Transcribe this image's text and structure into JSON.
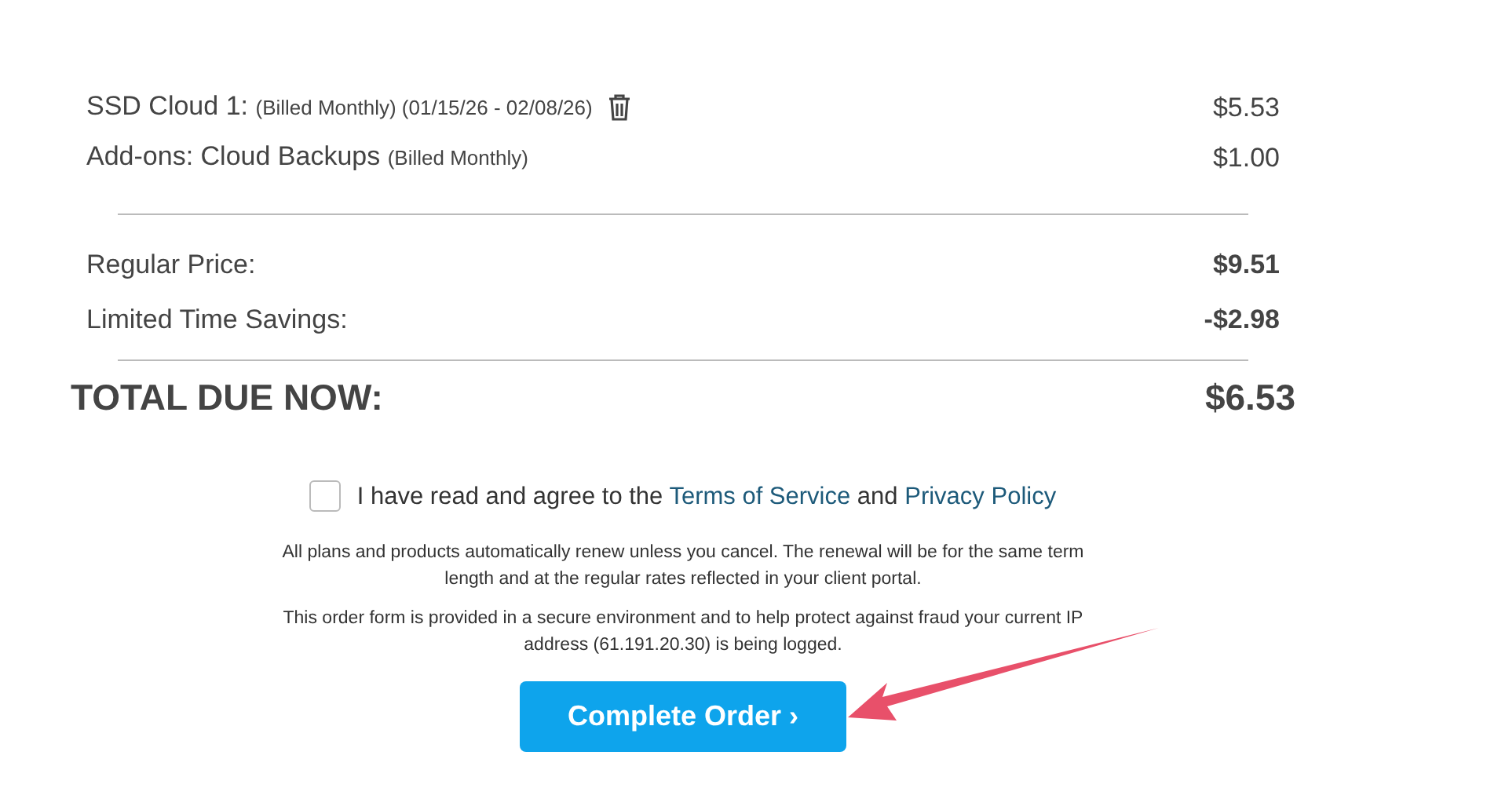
{
  "line_items": [
    {
      "name": "SSD Cloud 1:",
      "detail": "(Billed Monthly) (01/15/26 - 02/08/26)",
      "removable": true,
      "price": "$5.53"
    },
    {
      "name": "Add-ons: Cloud Backups",
      "detail": "(Billed Monthly)",
      "removable": false,
      "price": "$1.00"
    }
  ],
  "summary": [
    {
      "label": "Regular Price:",
      "value": "$9.51"
    },
    {
      "label": "Limited Time Savings:",
      "value": "-$2.98"
    }
  ],
  "total": {
    "label": "TOTAL DUE NOW:",
    "value": "$6.53"
  },
  "agreement": {
    "checked": false,
    "text": "I have read and agree to the",
    "terms_link": "Terms of Service",
    "joiner": "and",
    "privacy_link": "Privacy Policy"
  },
  "notices": [
    "All plans and products automatically renew unless you cancel. The renewal will be for the same term length and at the regular rates reflected in your client portal.",
    "This order form is provided in a secure environment and to help protect against fraud your current IP address (61.191.20.30) is being logged."
  ],
  "submit": {
    "label": "Complete Order",
    "caret": "›"
  },
  "annotation": {
    "kind": "arrow"
  }
}
